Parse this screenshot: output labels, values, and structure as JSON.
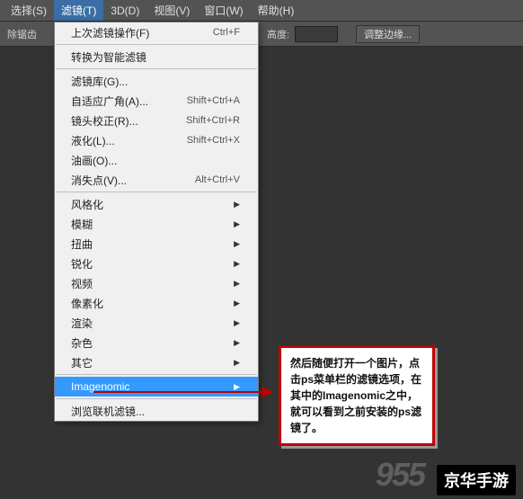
{
  "menubar": {
    "items": [
      {
        "label": "选择(S)"
      },
      {
        "label": "滤镜(T)"
      },
      {
        "label": "3D(D)"
      },
      {
        "label": "视图(V)"
      },
      {
        "label": "窗口(W)"
      },
      {
        "label": "帮助(H)"
      }
    ]
  },
  "toolbar": {
    "antialias": "除锯齿",
    "height_label": "高度:",
    "height_value": "",
    "adjust_edge": "调整边缘..."
  },
  "dropdown": {
    "groups": [
      [
        {
          "label": "上次滤镜操作(F)",
          "shortcut": "Ctrl+F",
          "sub": false
        }
      ],
      [
        {
          "label": "转换为智能滤镜",
          "shortcut": "",
          "sub": false
        }
      ],
      [
        {
          "label": "滤镜库(G)...",
          "shortcut": "",
          "sub": false
        },
        {
          "label": "自适应广角(A)...",
          "shortcut": "Shift+Ctrl+A",
          "sub": false
        },
        {
          "label": "镜头校正(R)...",
          "shortcut": "Shift+Ctrl+R",
          "sub": false
        },
        {
          "label": "液化(L)...",
          "shortcut": "Shift+Ctrl+X",
          "sub": false
        },
        {
          "label": "油画(O)...",
          "shortcut": "",
          "sub": false
        },
        {
          "label": "消失点(V)...",
          "shortcut": "Alt+Ctrl+V",
          "sub": false
        }
      ],
      [
        {
          "label": "风格化",
          "shortcut": "",
          "sub": true
        },
        {
          "label": "模糊",
          "shortcut": "",
          "sub": true
        },
        {
          "label": "扭曲",
          "shortcut": "",
          "sub": true
        },
        {
          "label": "锐化",
          "shortcut": "",
          "sub": true
        },
        {
          "label": "视频",
          "shortcut": "",
          "sub": true
        },
        {
          "label": "像素化",
          "shortcut": "",
          "sub": true
        },
        {
          "label": "渲染",
          "shortcut": "",
          "sub": true
        },
        {
          "label": "杂色",
          "shortcut": "",
          "sub": true
        },
        {
          "label": "其它",
          "shortcut": "",
          "sub": true
        }
      ],
      [
        {
          "label": "Imagenomic",
          "shortcut": "",
          "sub": true,
          "highlighted": true
        }
      ],
      [
        {
          "label": "浏览联机滤镜...",
          "shortcut": "",
          "sub": false
        }
      ]
    ]
  },
  "callout": {
    "text": "然后随便打开一个图片，点击ps菜单栏的滤镜选项，在其中的Imagenomic之中，就可以看到之前安装的ps滤镜了。"
  },
  "watermarks": {
    "w1": "955",
    "w2": "京华手游"
  }
}
